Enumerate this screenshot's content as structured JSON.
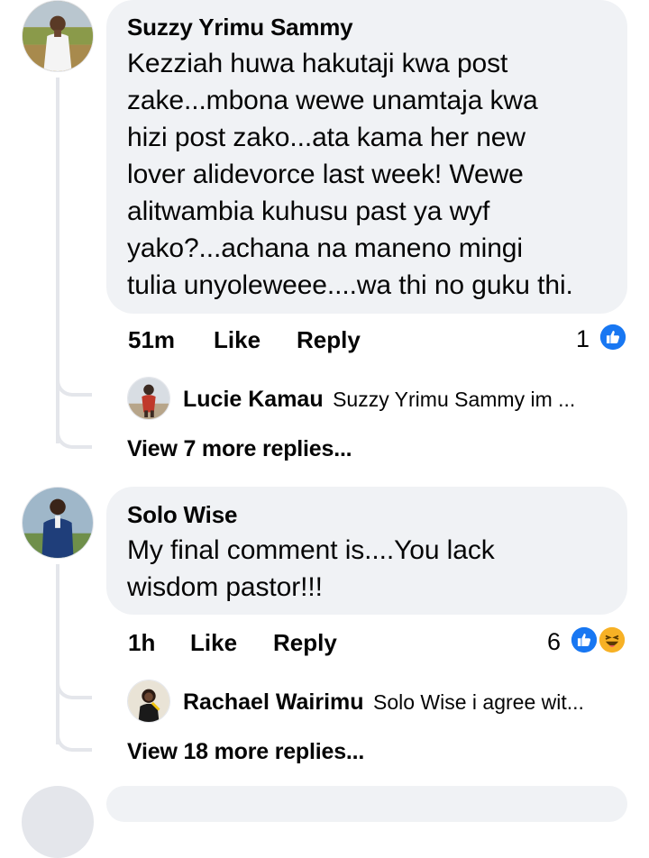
{
  "comments": [
    {
      "author": "Suzzy Yrimu Sammy",
      "lines": [
        "Kezziah huwa hakutaji kwa post",
        "zake...mbona wewe unamtaja kwa",
        "hizi post zako...ata kama her new",
        "lover alidevorce last week! Wewe",
        "alitwambia kuhusu past ya wyf",
        "yako?...achana na maneno mingi",
        "tulia unyoleweee....wa thi no guku thi."
      ],
      "time": "51m",
      "like_label": "Like",
      "reply_label": "Reply",
      "reaction_count": "1",
      "reactions": [
        "like-icon"
      ],
      "reply_preview": {
        "author": "Lucie Kamau",
        "snippet": "Suzzy Yrimu Sammy im ..."
      },
      "view_more": "View 7 more replies..."
    },
    {
      "author": "Solo Wise",
      "lines": [
        "My final comment is....You lack",
        "wisdom pastor!!!"
      ],
      "time": "1h",
      "like_label": "Like",
      "reply_label": "Reply",
      "reaction_count": "6",
      "reactions": [
        "like-icon",
        "haha-icon"
      ],
      "reply_preview": {
        "author": "Rachael Wairimu",
        "snippet": "Solo Wise i agree wit..."
      },
      "view_more": "View 18 more replies..."
    }
  ],
  "colors": {
    "bubble": "#f0f2f5",
    "thread_line": "#e4e6eb",
    "like_blue": "#1877f2",
    "haha_yellow": "#f7b125",
    "text": "#050505"
  }
}
